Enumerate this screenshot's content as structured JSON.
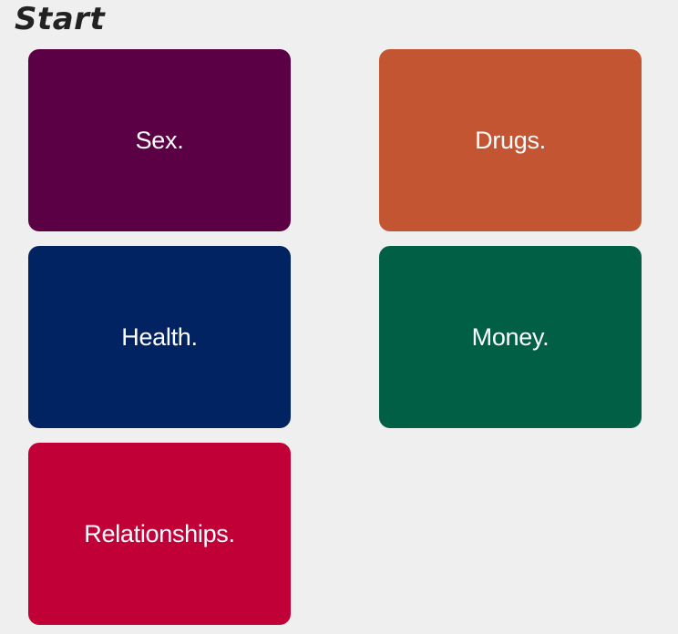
{
  "header": {
    "title": "Start"
  },
  "categories": [
    {
      "label": "Sex.",
      "color": "#5b0045"
    },
    {
      "label": "Drugs.",
      "color": "#c45532"
    },
    {
      "label": "Health.",
      "color": "#022361"
    },
    {
      "label": "Money.",
      "color": "#015f46"
    },
    {
      "label": "Relationships.",
      "color": "#c20038"
    }
  ]
}
